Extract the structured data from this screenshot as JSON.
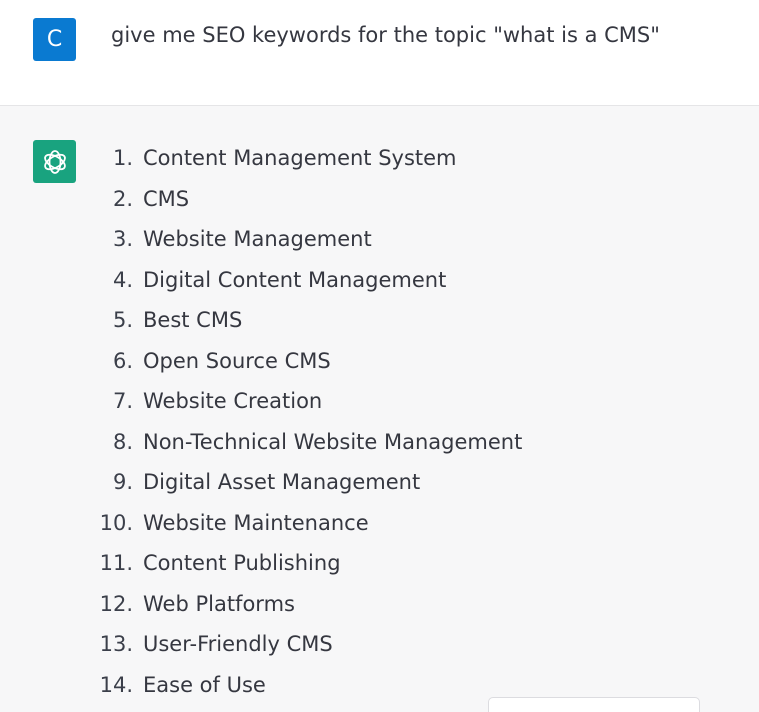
{
  "user_message": {
    "avatar_letter": "C",
    "text": "give me SEO keywords for the topic \"what is a CMS\""
  },
  "assistant_message": {
    "avatar_icon": "openai-logo-icon",
    "keywords": [
      {
        "num": "1.",
        "text": "Content Management System"
      },
      {
        "num": "2.",
        "text": "CMS"
      },
      {
        "num": "3.",
        "text": "Website Management"
      },
      {
        "num": "4.",
        "text": "Digital Content Management"
      },
      {
        "num": "5.",
        "text": "Best CMS"
      },
      {
        "num": "6.",
        "text": "Open Source CMS"
      },
      {
        "num": "7.",
        "text": "Website Creation"
      },
      {
        "num": "8.",
        "text": "Non-Technical Website Management"
      },
      {
        "num": "9.",
        "text": "Digital Asset Management"
      },
      {
        "num": "10.",
        "text": "Website Maintenance"
      },
      {
        "num": "11.",
        "text": "Content Publishing"
      },
      {
        "num": "12.",
        "text": "Web Platforms"
      },
      {
        "num": "13.",
        "text": "User-Friendly CMS"
      },
      {
        "num": "14.",
        "text": "Ease of Use"
      }
    ]
  },
  "colors": {
    "user_avatar": "#0a7ad1",
    "bot_avatar": "#19a37f",
    "assistant_bg": "#f7f7f8"
  }
}
